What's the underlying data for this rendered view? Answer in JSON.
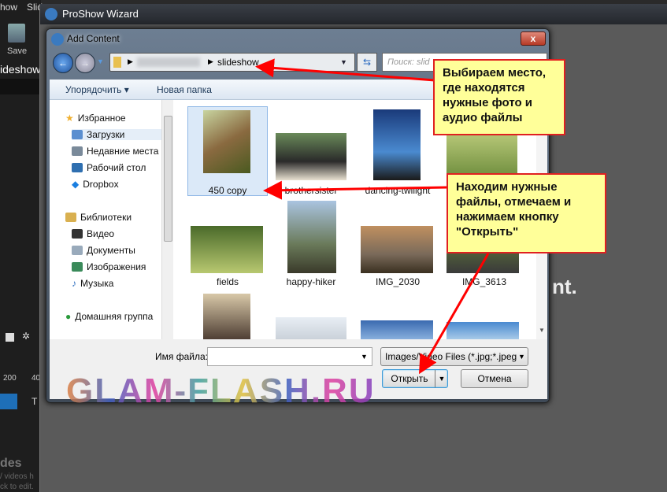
{
  "app": {
    "menu": [
      "how",
      "Slid"
    ],
    "save_label": "Save",
    "tab_label": "ideshow",
    "ruler_tick": "200",
    "ruler_tick2": "40",
    "bottom_title": "des",
    "bottom_text1": "/ videos h",
    "bottom_text2": "ck to edit.",
    "tab2": "T"
  },
  "wizard": {
    "title": "ProShow Wizard",
    "bg_text": "nt."
  },
  "dialog": {
    "title": "Add Content",
    "close_label": "x",
    "address": {
      "path_current": "slideshow"
    },
    "search_placeholder": "Поиск: slid",
    "toolbar": {
      "organize": "Упорядочить ▾",
      "new_folder": "Новая папка"
    },
    "nav": [
      {
        "label": "Избранное",
        "icon": "star-icon",
        "color": "#f0b030"
      },
      {
        "label": "Загрузки",
        "icon": "downloads-folder-icon",
        "color": "#5b8fd0"
      },
      {
        "label": "Недавние места",
        "icon": "recent-places-icon",
        "color": "#7a8a9a"
      },
      {
        "label": "Рабочий стол",
        "icon": "desktop-icon",
        "color": "#2f6fb0"
      },
      {
        "label": "Dropbox",
        "icon": "dropbox-icon",
        "color": "#1a7ee0"
      },
      {
        "label": "Библиотеки",
        "icon": "libraries-icon",
        "color": "#d9b050"
      },
      {
        "label": "Видео",
        "icon": "video-icon",
        "color": "#333"
      },
      {
        "label": "Документы",
        "icon": "documents-icon",
        "color": "#9ab"
      },
      {
        "label": "Изображения",
        "icon": "images-icon",
        "color": "#3a8a5a"
      },
      {
        "label": "Музыка",
        "icon": "music-icon",
        "color": "#3070c0"
      },
      {
        "label": "Домашняя группа",
        "icon": "homegroup-icon",
        "color": "#2a9a3a"
      }
    ],
    "files": [
      {
        "name": "450 copy",
        "selected": true
      },
      {
        "name": "brothersister"
      },
      {
        "name": "dancing-twilight"
      },
      {
        "name": ""
      },
      {
        "name": "fields"
      },
      {
        "name": "happy-hiker"
      },
      {
        "name": "IMG_2030"
      },
      {
        "name": "IMG_3613"
      }
    ],
    "filename_label": "Имя файла:",
    "filename_value": "",
    "filter": "Images/Video Files (*.jpg;*.jpeg",
    "open": "Открыть",
    "cancel": "Отмена"
  },
  "callouts": {
    "first": "Выбираем место, где находятся нужные фото и аудио файлы",
    "second": "Находим нужные файлы, отмечаем и нажимаем кнопку \"Открыть\""
  },
  "watermark": "GLAM-FLASH.RU"
}
